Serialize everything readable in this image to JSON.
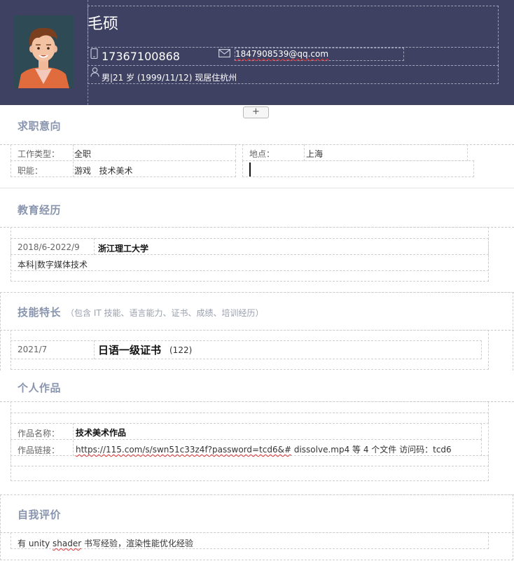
{
  "header": {
    "name": "毛硕",
    "phone": "17367100868",
    "email": "1847908539@qq.com",
    "basic_info": "男|21 岁 (1999/11/12) 现居住杭州"
  },
  "add_label": "+",
  "job_intent": {
    "title": "求职意向",
    "type_label": "工作类型：",
    "type_value": "全职",
    "location_label": "地点：",
    "location_value": "上海",
    "function_label": "职能：",
    "function_value": "游戏   技术美术"
  },
  "education": {
    "title": "教育经历",
    "period": "2018/6-2022/9",
    "school": "浙江理工大学",
    "degree": "本科|数字媒体技术"
  },
  "skills": {
    "title": "技能特长",
    "note": "（包含 IT 技能、语言能力、证书、成绩、培训经历）",
    "date": "2021/7",
    "cert": "日语一级证书",
    "score": "(122)"
  },
  "works": {
    "title": "个人作品",
    "name_label": "作品名称：",
    "name_value": "技术美术作品",
    "link_label": "作品链接：",
    "link_url": "https://115.com/s/swn51c33z4f?password=tcd6&#",
    "link_rest": " dissolve.mp4 等 4 个文件 访问码：tcd6"
  },
  "self_eval": {
    "title": "自我评价",
    "text_prefix": "有 unity ",
    "text_flagged": "shader",
    "text_suffix": " 书写经验，渲染性能优化经验"
  },
  "colors": {
    "header_bg": "#3f4163",
    "section_title": "#8995ae"
  },
  "icons": [
    "avatar-illustration",
    "phone-icon",
    "mail-icon",
    "person-icon"
  ]
}
